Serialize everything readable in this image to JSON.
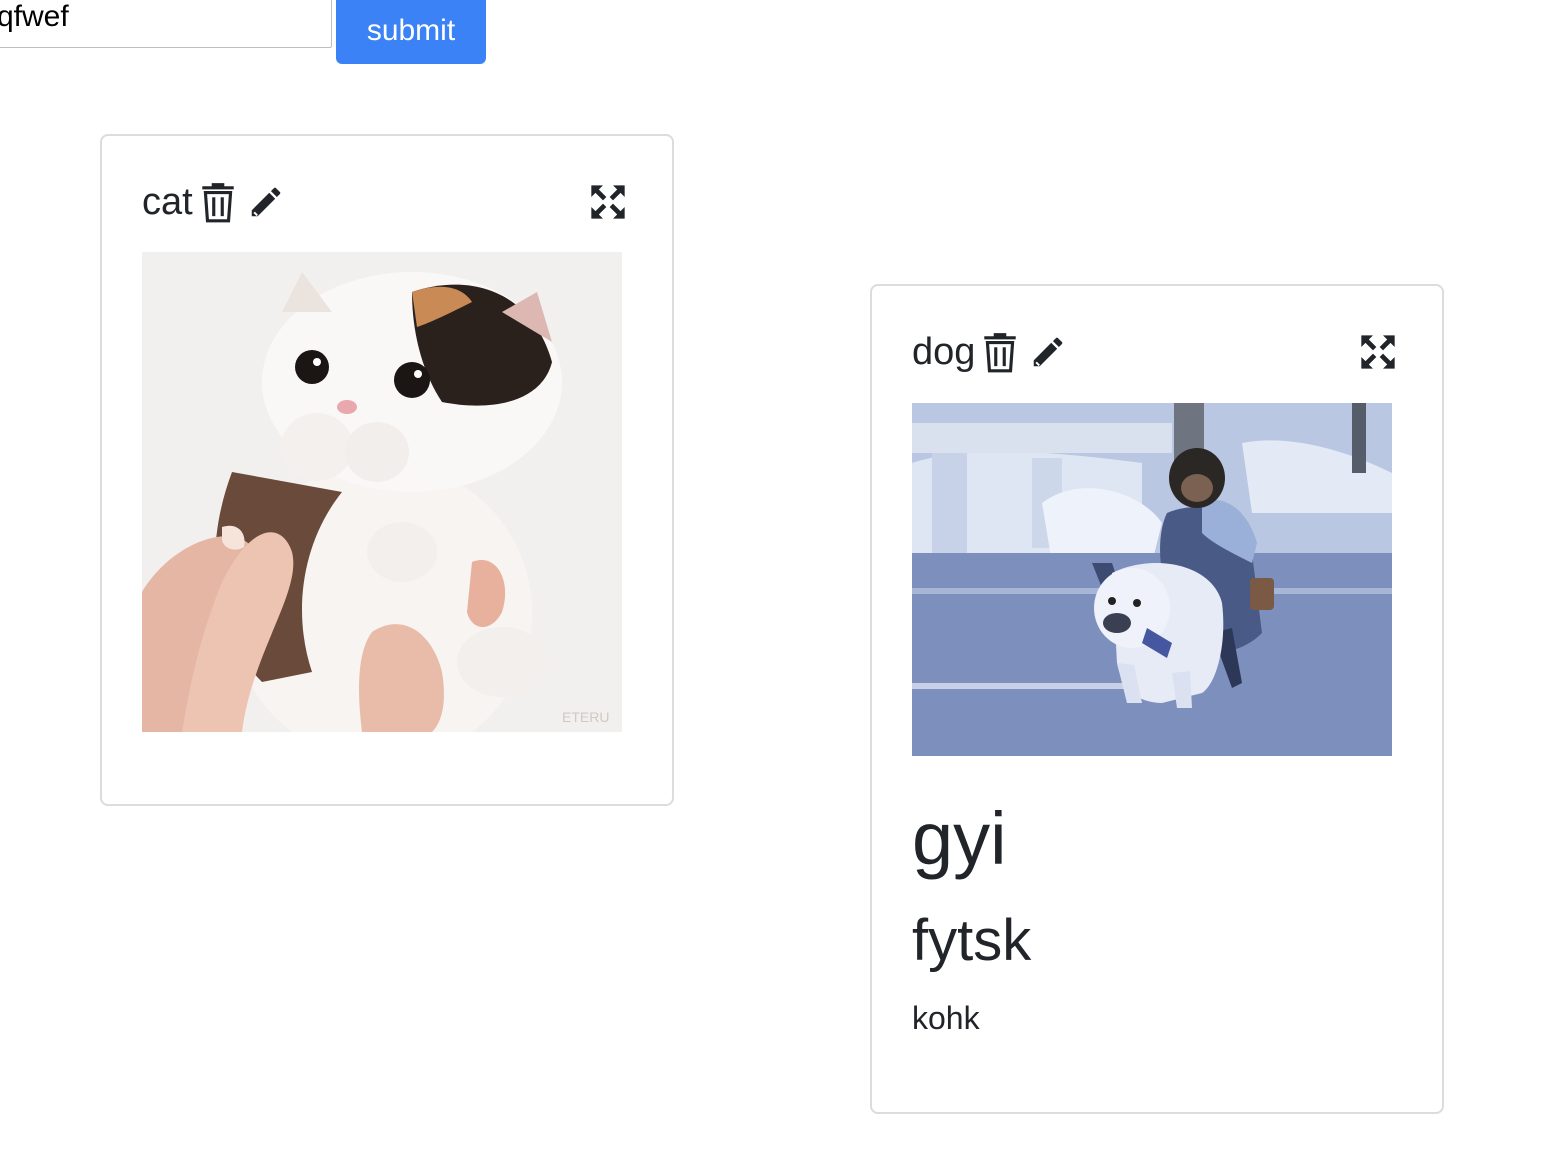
{
  "form": {
    "input_value": "qfwef",
    "submit_label": "submit",
    "submit_color": "#3b82f6"
  },
  "cards": [
    {
      "title": "cat",
      "icons": [
        "trash-icon",
        "pencil-icon",
        "expand-icon"
      ],
      "image": "kitten-photo",
      "image_watermark": "ETERU"
    },
    {
      "title": "dog",
      "icons": [
        "trash-icon",
        "pencil-icon",
        "expand-icon"
      ],
      "image": "chimp-riding-bulldog-photo",
      "heading": "gyi",
      "subheading": "fytsk",
      "body": "kohk"
    }
  ]
}
